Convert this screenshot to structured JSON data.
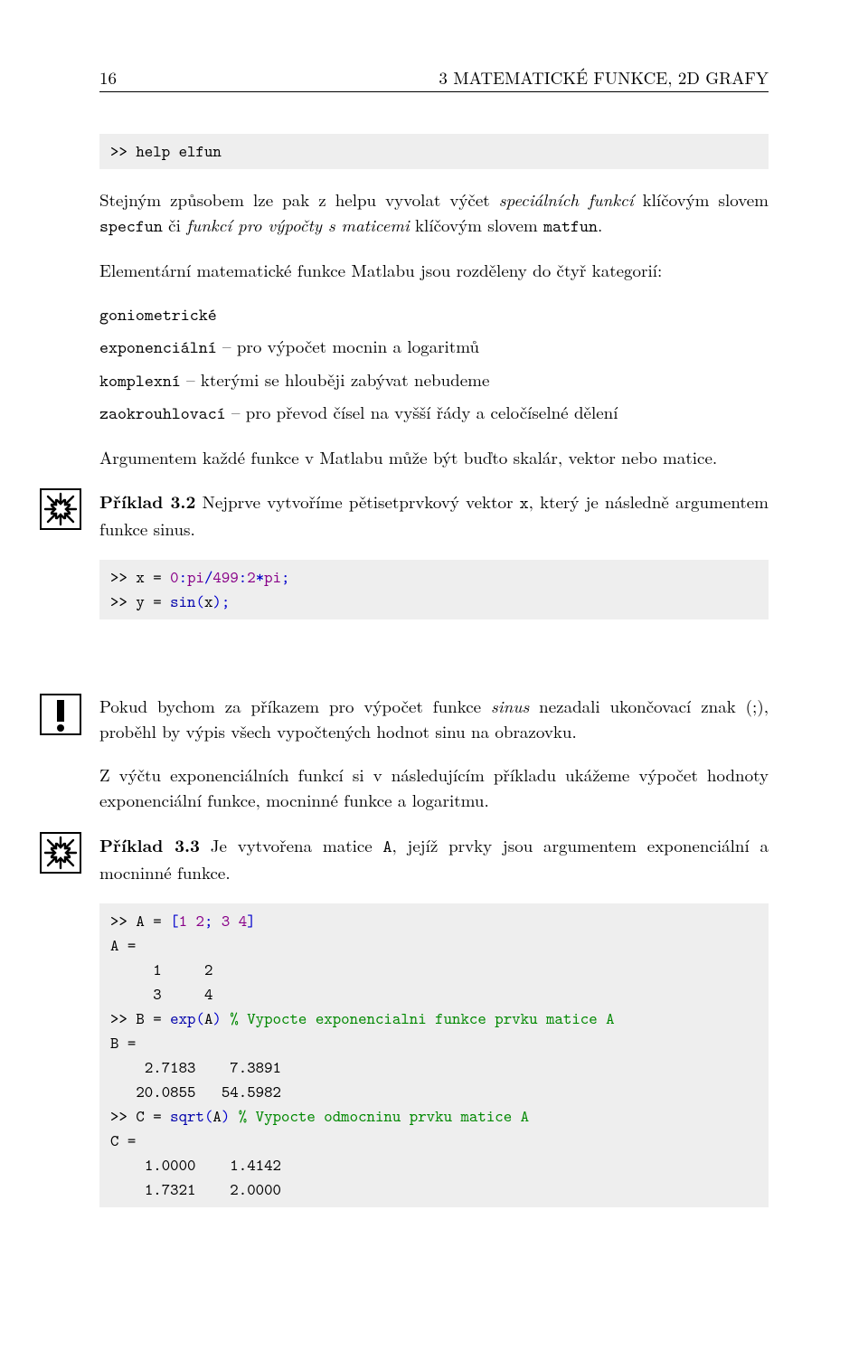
{
  "header": {
    "page_number": "16",
    "section_title": "3   MATEMATICKÉ FUNKCE, 2D GRAFY"
  },
  "code1": {
    "line1": ">> help elfun"
  },
  "para1": {
    "t1": "Stejným způsobem lze pak z helpu vyvolat výčet ",
    "i1": "speciálních funkcí",
    "t2": " klíčovým slovem ",
    "tt1": "specfun",
    "t3": " či ",
    "i2": "funkcí pro výpočty s maticemi",
    "t4": " klíčovým slovem ",
    "tt2": "matfun",
    "t5": "."
  },
  "para2": "Elementární matematické funkce Matlabu jsou rozděleny do čtyř kategorií:",
  "defs": {
    "d1": {
      "term": "goniometrické",
      "desc": ""
    },
    "d2": {
      "term": "exponenciální",
      "desc": " – pro výpočet mocnin a logaritmů"
    },
    "d3": {
      "term": "komplexní",
      "desc": " – kterými se hlouběji zabývat nebudeme"
    },
    "d4": {
      "term": "zaokrouhlovací",
      "desc": " – pro převod čísel na vyšší řády a celočíselné dělení"
    }
  },
  "para3": "Argumentem každé funkce v Matlabu může být buďto skalár, vektor nebo matice.",
  "example32": {
    "label": "Příklad 3.2",
    "pre": "   Nejprve vytvoříme pětisetprvkový vektor ",
    "tt": "x",
    "post": ", který je následně argumentem funkce sinus."
  },
  "code2": {
    "l1a": ">> x = ",
    "l1b": "0",
    "l1c": ":",
    "l1d": "pi",
    "l1e": "/",
    "l1f": "499",
    "l1g": ":",
    "l1h": "2",
    "l1i": "*",
    "l1j": "pi",
    "l1k": ";",
    "l2a": ">> y = ",
    "l2b": "sin",
    "l2c": "(",
    "l2d": "x",
    "l2e": ")",
    "l2f": ";"
  },
  "warn": {
    "t1": "Pokud bychom za příkazem pro výpočet funkce ",
    "i1": "sinus",
    "t2": " nezadali ukončovací znak (;), proběhl by výpis všech vypočtených hodnot sinu na obrazovku."
  },
  "para4": "Z výčtu exponenciálních funkcí si v následujícím příkladu ukážeme výpočet hodnoty exponenciální funkce, mocninné funkce a logaritmu.",
  "example33": {
    "label": "Příklad 3.3",
    "pre": "   Je vytvořena matice ",
    "tt": "A",
    "post": ", jejíž prvky jsou argumentem exponenciální a mocninné funkce."
  },
  "code3": {
    "l1a": ">> A = ",
    "l1b": "[",
    "l1c": "1 2",
    "l1d": ";",
    "l1e": " 3 4",
    "l1f": "]",
    "l2": "A =",
    "l3": "     1     2",
    "l4": "     3     4",
    "l5a": ">> B = ",
    "l5b": "exp",
    "l5c": "(",
    "l5d": "A",
    "l5e": ")",
    "l5f": " % Vypocte exponencialni funkce prvku matice A",
    "l6": "B =",
    "l7": "    2.7183    7.3891",
    "l8": "   20.0855   54.5982",
    "l9a": ">> C = ",
    "l9b": "sqrt",
    "l9c": "(",
    "l9d": "A",
    "l9e": ")",
    "l9f": " % Vypocte odmocninu prvku matice A",
    "l10": "C =",
    "l11": "    1.0000    1.4142",
    "l12": "    1.7321    2.0000"
  }
}
